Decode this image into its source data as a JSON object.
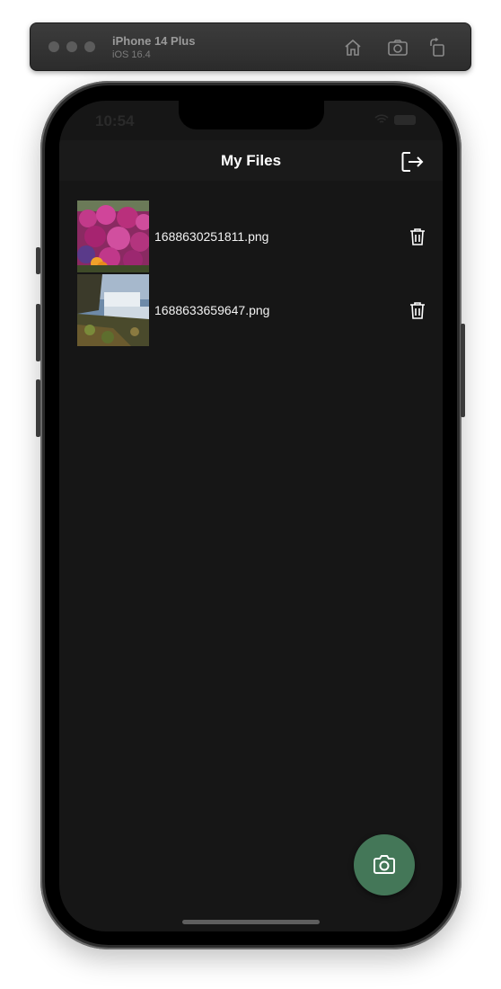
{
  "simulator": {
    "device_name": "iPhone 14 Plus",
    "os_version": "iOS 16.4",
    "buttons": [
      "home-icon",
      "screenshot-icon",
      "rotate-icon"
    ]
  },
  "status_bar": {
    "time": "10:54"
  },
  "nav": {
    "title": "My Files",
    "action_icon": "logout-icon"
  },
  "files": [
    {
      "name": "1688630251811.png",
      "thumbnail": "flowers-photo",
      "action_icon": "trash-icon"
    },
    {
      "name": "1688633659647.png",
      "thumbnail": "waterfall-photo",
      "action_icon": "trash-icon"
    }
  ],
  "fab": {
    "icon": "camera-icon",
    "color": "#447758"
  },
  "colors": {
    "screen_background": "#161616",
    "nav_background": "#1a1a1a",
    "text": "#ffffff"
  }
}
